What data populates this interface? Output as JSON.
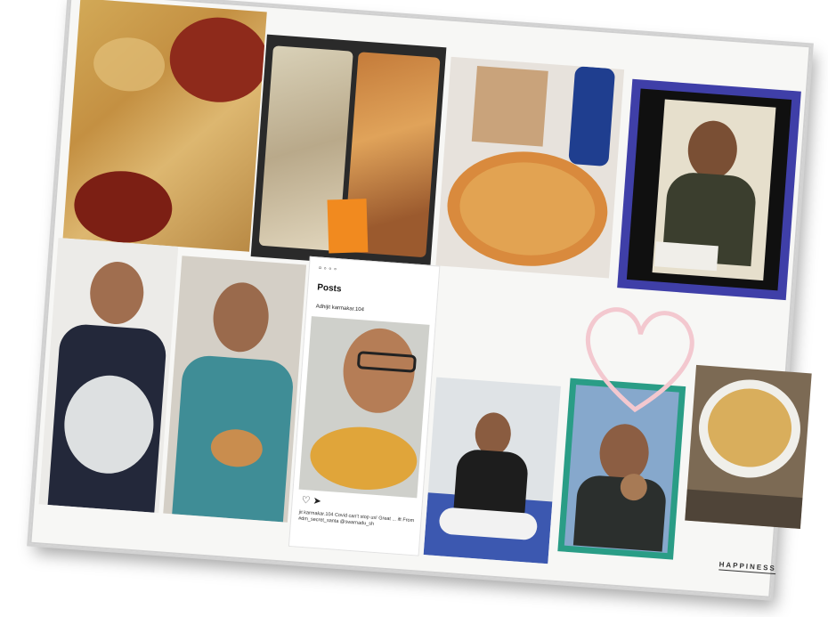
{
  "instagram_post": {
    "header_title": "Posts",
    "username": "Adhijit karmakar.104",
    "caption": "jit karmakar.104 Covid can't stop us! Great ... ift From #dm_secret_santa @swarnadu_sh"
  },
  "brand_label": "HAPPINESS",
  "accent_colors": {
    "frame_blue": "#3f3fa8",
    "frame_teal": "#2a9d86",
    "heart_pink": "#f3c8cf"
  }
}
